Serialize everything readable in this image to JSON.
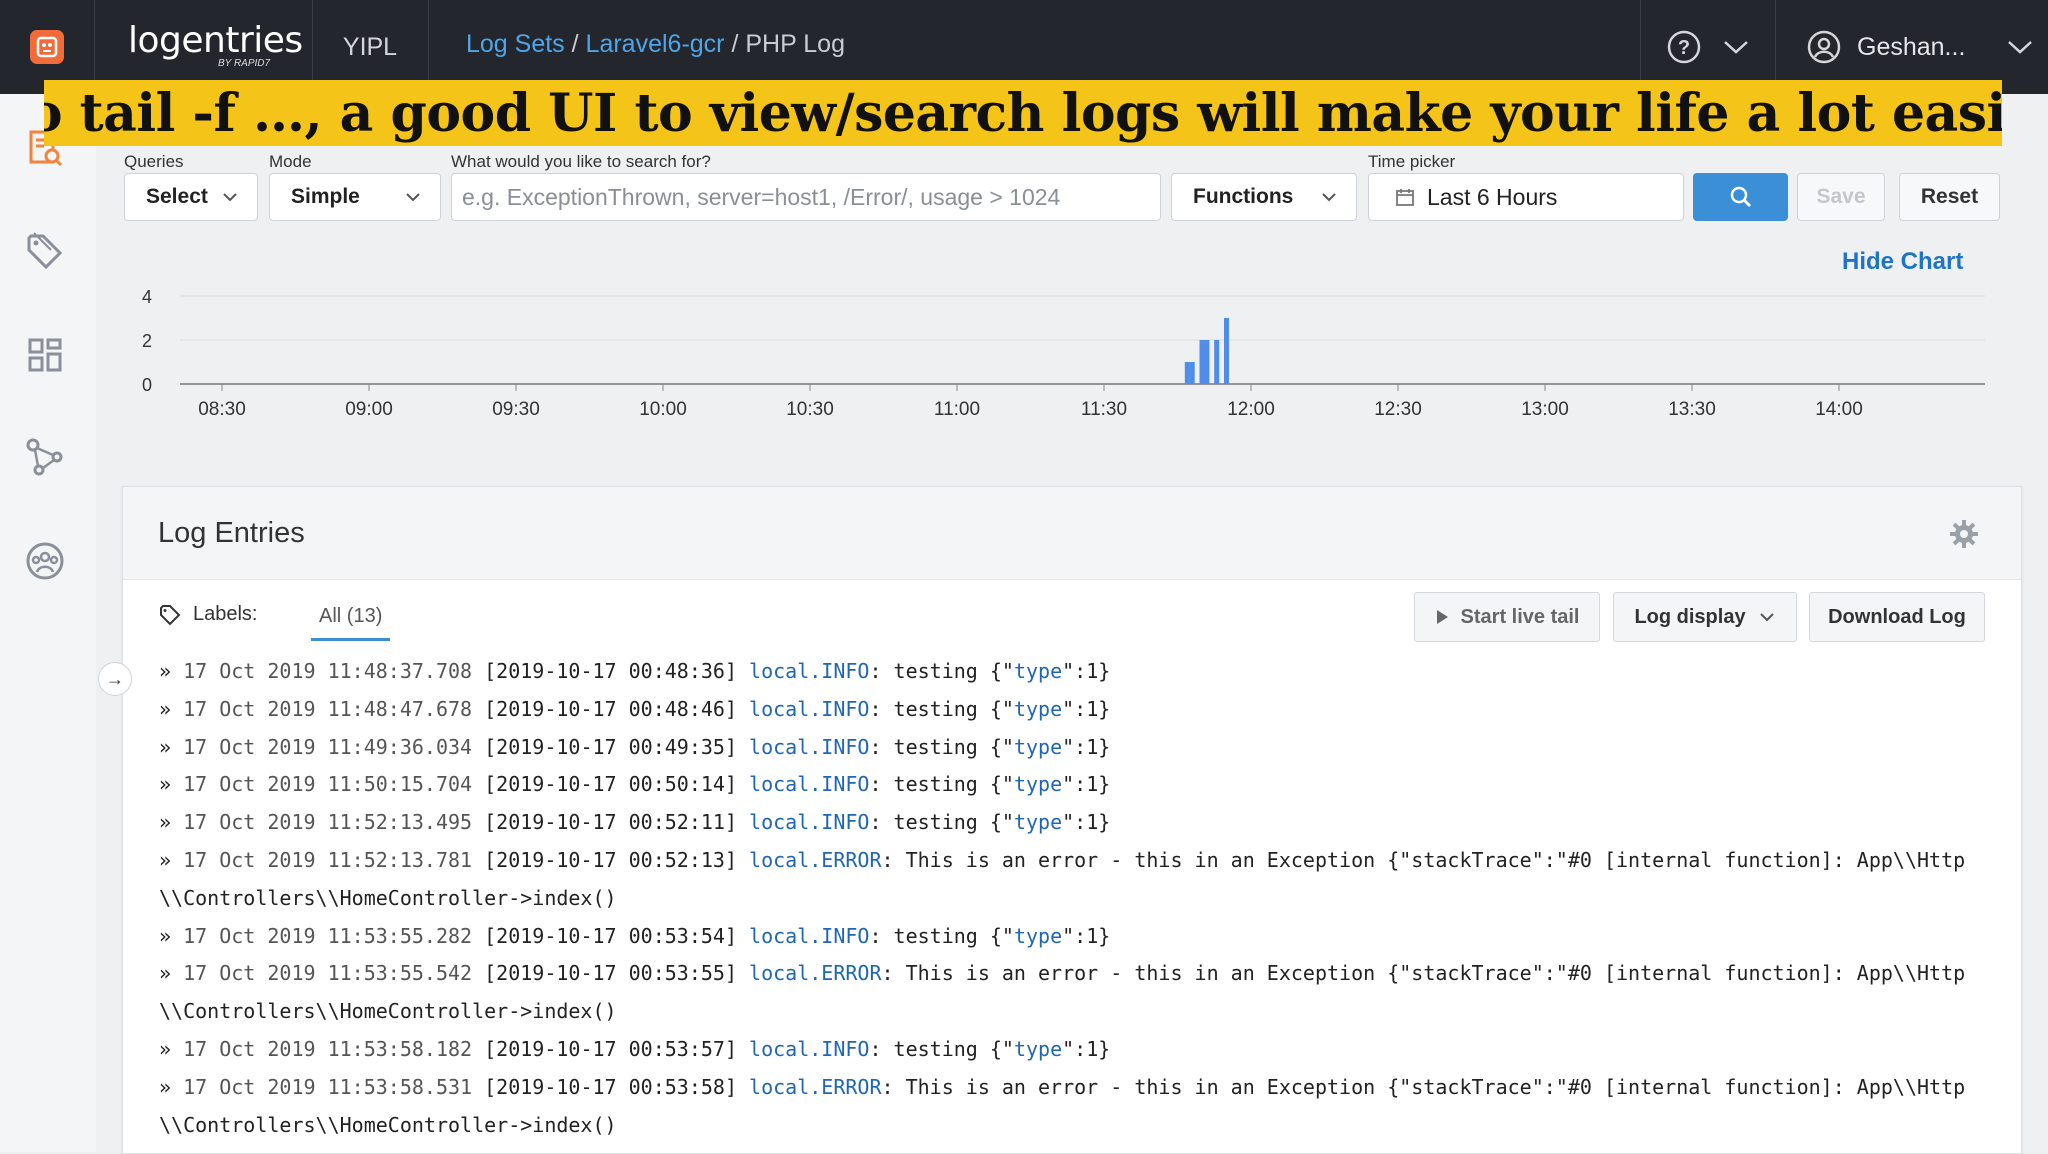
{
  "topbar": {
    "brand_main": "logentries",
    "brand_by": "BY RAPID7",
    "account": "YIPL",
    "breadcrumb": {
      "part1": "Log Sets",
      "sep1": "/",
      "part2": "Laravel6-gcr",
      "sep2": "/",
      "current": "PHP Log"
    },
    "user_name": "Geshan..."
  },
  "banner": "No tail -f …, a good UI to view/search logs will make your life a lot easier",
  "sidebar": {
    "icons": [
      "log-search-icon",
      "tag-icon",
      "dashboard-icon",
      "network-icon",
      "team-icon"
    ]
  },
  "query_bar": {
    "queries_label": "Queries",
    "queries_value": "Select",
    "mode_label": "Mode",
    "mode_value": "Simple",
    "search_label": "What would you like to search for?",
    "search_placeholder": "e.g. ExceptionThrown, server=host1, /Error/, usage > 1024",
    "functions_label": "Functions",
    "time_label": "Time picker",
    "time_value": "Last 6 Hours",
    "save_label": "Save",
    "reset_label": "Reset"
  },
  "hide_chart_label": "Hide Chart",
  "chart_data": {
    "type": "bar",
    "x_ticks": [
      "08:30",
      "09:00",
      "09:30",
      "10:00",
      "10:30",
      "11:00",
      "11:30",
      "12:00",
      "12:30",
      "13:00",
      "13:30",
      "14:00"
    ],
    "y_ticks": [
      "0",
      "2",
      "4"
    ],
    "ylim": [
      0,
      4
    ],
    "bars": [
      {
        "x": "11:47",
        "value": 1
      },
      {
        "x": "11:48",
        "value": 1
      },
      {
        "x": "11:50",
        "value": 2
      },
      {
        "x": "11:51",
        "value": 2
      },
      {
        "x": "11:53",
        "value": 2
      },
      {
        "x": "11:55",
        "value": 3
      }
    ],
    "bar_color": "#4f8de8",
    "grid": true
  },
  "panel": {
    "title": "Log Entries",
    "labels_label": "Labels:",
    "tab_all": "All (13)",
    "live_tail_label": "Start live tail",
    "log_display_label": "Log display",
    "download_label": "Download Log"
  },
  "logs": [
    {
      "ts": "17 Oct 2019 11:48:37.708",
      "bracket": "[2019-10-17 00:48:36]",
      "level": "local.INFO",
      "msg": ": testing {\"",
      "key": "type",
      "tail": "\":1}",
      "cont": ""
    },
    {
      "ts": "17 Oct 2019 11:48:47.678",
      "bracket": "[2019-10-17 00:48:46]",
      "level": "local.INFO",
      "msg": ": testing {\"",
      "key": "type",
      "tail": "\":1}",
      "cont": ""
    },
    {
      "ts": "17 Oct 2019 11:49:36.034",
      "bracket": "[2019-10-17 00:49:35]",
      "level": "local.INFO",
      "msg": ": testing {\"",
      "key": "type",
      "tail": "\":1}",
      "cont": ""
    },
    {
      "ts": "17 Oct 2019 11:50:15.704",
      "bracket": "[2019-10-17 00:50:14]",
      "level": "local.INFO",
      "msg": ": testing {\"",
      "key": "type",
      "tail": "\":1}",
      "cont": ""
    },
    {
      "ts": "17 Oct 2019 11:52:13.495",
      "bracket": "[2019-10-17 00:52:11]",
      "level": "local.INFO",
      "msg": ": testing {\"",
      "key": "type",
      "tail": "\":1}",
      "cont": ""
    },
    {
      "ts": "17 Oct 2019 11:52:13.781",
      "bracket": "[2019-10-17 00:52:13]",
      "level": "local.ERROR",
      "msg": ": This is an error - this in an Exception {\"stackTrace\":\"#0 [internal function]: App\\\\Http",
      "key": "",
      "tail": "",
      "cont": "\\\\Controllers\\\\HomeController->index()"
    },
    {
      "ts": "17 Oct 2019 11:53:55.282",
      "bracket": "[2019-10-17 00:53:54]",
      "level": "local.INFO",
      "msg": ": testing {\"",
      "key": "type",
      "tail": "\":1}",
      "cont": ""
    },
    {
      "ts": "17 Oct 2019 11:53:55.542",
      "bracket": "[2019-10-17 00:53:55]",
      "level": "local.ERROR",
      "msg": ": This is an error - this in an Exception {\"stackTrace\":\"#0 [internal function]: App\\\\Http",
      "key": "",
      "tail": "",
      "cont": "\\\\Controllers\\\\HomeController->index()"
    },
    {
      "ts": "17 Oct 2019 11:53:58.182",
      "bracket": "[2019-10-17 00:53:57]",
      "level": "local.INFO",
      "msg": ": testing {\"",
      "key": "type",
      "tail": "\":1}",
      "cont": ""
    },
    {
      "ts": "17 Oct 2019 11:53:58.531",
      "bracket": "[2019-10-17 00:53:58]",
      "level": "local.ERROR",
      "msg": ": This is an error - this in an Exception {\"stackTrace\":\"#0 [internal function]: App\\\\Http",
      "key": "",
      "tail": "",
      "cont": "\\\\Controllers\\\\HomeController->index()"
    }
  ]
}
